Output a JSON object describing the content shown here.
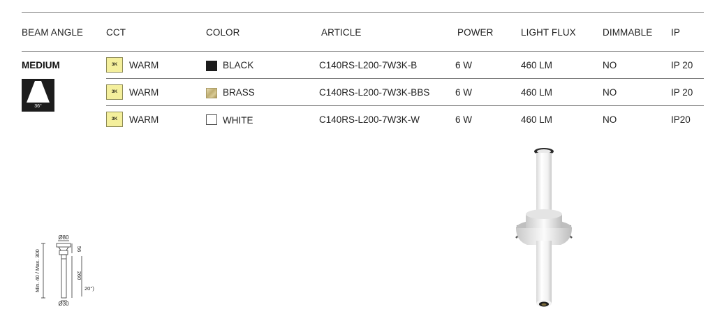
{
  "headers": {
    "beam_angle": "BEAM ANGLE",
    "cct": "CCT",
    "color": "COLOR",
    "article": "ARTICLE",
    "power": "POWER",
    "light_flux": "LIGHT FLUX",
    "dimmable": "DIMMABLE",
    "ip": "IP"
  },
  "beam": {
    "name": "MEDIUM",
    "angle": "36°"
  },
  "rows": [
    {
      "cct_code": "3K",
      "cct": "WARM",
      "color": "BLACK",
      "color_hex": "#1b1b1b",
      "article": "C140RS-L200-7W3K-B",
      "power": "6 W",
      "flux": "460 LM",
      "dimmable": "NO",
      "ip": "IP 20"
    },
    {
      "cct_code": "3K",
      "cct": "WARM",
      "color": "BRASS",
      "color_hex": "#c9b57a",
      "article": "C140RS-L200-7W3K-BBS",
      "power": "6 W",
      "flux": "460 LM",
      "dimmable": "NO",
      "ip": "IP 20"
    },
    {
      "cct_code": "3K",
      "cct": "WARM",
      "color": "WHITE",
      "color_hex": "#ffffff",
      "article": "C140RS-L200-7W3K-W",
      "power": "6 W",
      "flux": "460 LM",
      "dimmable": "NO",
      "ip": "IP20"
    }
  ],
  "drawing": {
    "top_diameter": "Ø80",
    "bottom_diameter": "Ø30",
    "height_top": "56",
    "height_body": "260",
    "side_label": "Min. 40 / Max. 300",
    "tilt": "20°)"
  }
}
